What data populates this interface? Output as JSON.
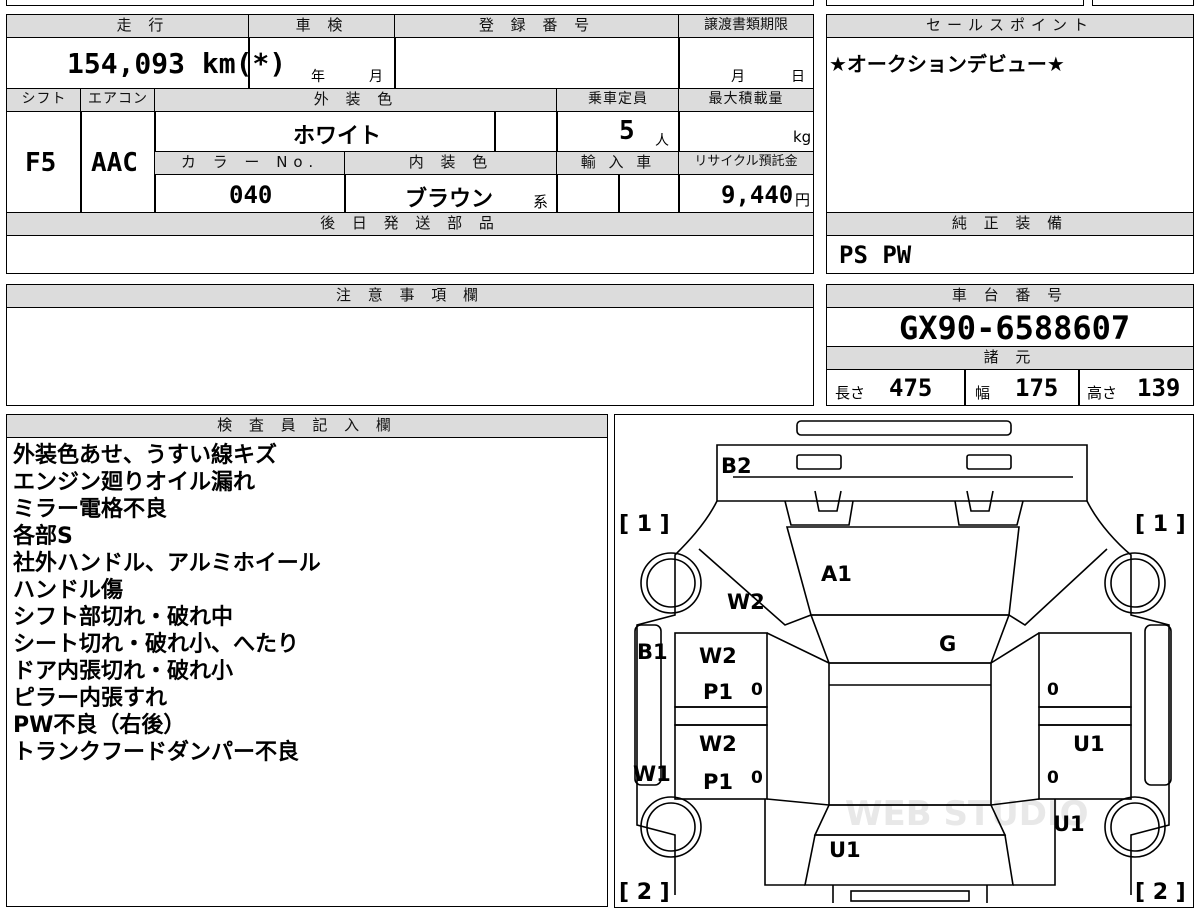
{
  "top": {
    "mileage_label": "走 行",
    "mileage": "154,093 km(*)",
    "inspection_label": "車 検",
    "inspection_year_unit": "年",
    "inspection_month_unit": "月",
    "registration_label": "登 録 番 号",
    "transfer_label": "譲渡書類期限",
    "transfer_month_unit": "月",
    "transfer_day_unit": "日",
    "shift_label": "シフト",
    "ac_label": "エアコン",
    "exterior_label": "外 装 色",
    "capacity_label": "乗車定員",
    "maxload_label": "最大積載量",
    "shift": "F5",
    "ac": "AAC",
    "exterior_color": "ホワイト",
    "capacity": "5",
    "capacity_unit": "人",
    "maxload_unit": "kg",
    "color_no_label": "カ ラ ー No.",
    "interior_label": "内 装 色",
    "import_label": "輸 入 車",
    "recycle_label": "リサイクル預託金",
    "color_no": "040",
    "interior_color": "ブラウン",
    "interior_suffix": "系",
    "recycle_fee": "9,440",
    "recycle_unit": "円",
    "later_parts_label": "後 日 発 送 部 品"
  },
  "sales": {
    "label": "セールスポイント",
    "text": "★オークションデビュー★"
  },
  "equipment": {
    "label": "純 正 装 備",
    "text": "PS PW"
  },
  "caution": {
    "label": "注 意 事 項 欄"
  },
  "chassis": {
    "label": "車 台 番 号",
    "number": "GX90-6588607",
    "spec_label": "諸 元",
    "length_label": "長さ",
    "length": "475",
    "width_label": "幅",
    "width": "175",
    "height_label": "高さ",
    "height": "139"
  },
  "inspector": {
    "label": "検 査 員 記 入 欄",
    "lines": [
      "外装色あせ、うすい線キズ",
      "エンジン廻りオイル漏れ",
      "ミラー電格不良",
      "各部S",
      "社外ハンドル、アルミホイール",
      "ハンドル傷",
      "シフト部切れ・破れ中",
      "シート切れ・破れ小、へたり",
      "ドア内張切れ・破れ小",
      "ピラー内張すれ",
      "PW不良（右後）",
      "トランクフードダンパー不良"
    ]
  },
  "diagram": {
    "corner_front_left": "[ 1 ]",
    "corner_front_right": "[ 1 ]",
    "corner_rear_left": "[ 2 ]",
    "corner_rear_right": "[ 2 ]",
    "marks": {
      "b2": "B2",
      "a1": "A1",
      "w2_hood": "W2",
      "g": "G",
      "b1": "B1",
      "w2_front_door": "W2",
      "p1_front_door": "P1",
      "w2_rear_door": "W2",
      "p1_rear_door": "P1",
      "w1": "W1",
      "u1_right_rear": "U1",
      "u1_right_quarter": "U1",
      "u1_trunk": "U1",
      "zero_lf": "0",
      "zero_lr": "0",
      "zero_rf": "0",
      "zero_rr": "0"
    },
    "watermark": "WEB STUDIO"
  }
}
